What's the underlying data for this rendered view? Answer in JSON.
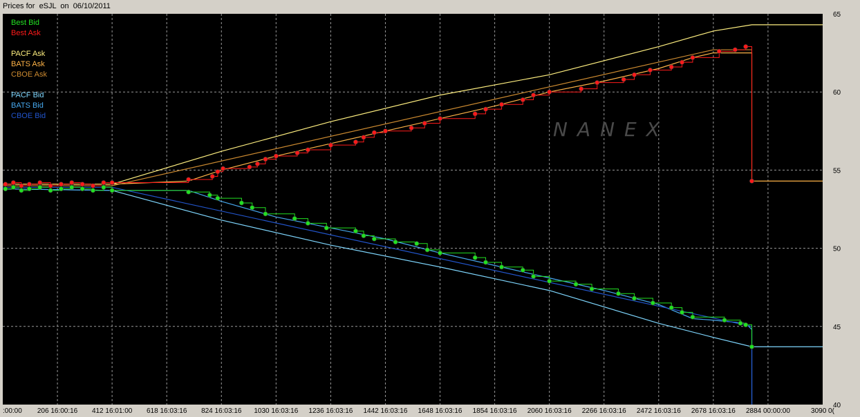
{
  "window": {
    "title": "Prices for  eSJL  on  06/10/2011"
  },
  "watermark": "NANEX",
  "colors": {
    "background": "#000000",
    "grid": "#9a9a9a",
    "best_bid": "#22e022",
    "best_ask": "#ff1a1a",
    "pacf_ask": "#ffef80",
    "bats_ask": "#ffb347",
    "cboe_ask": "#cc8a30",
    "pacf_bid": "#7fd7ff",
    "bats_bid": "#46a8ee",
    "cboe_bid": "#2255cc"
  },
  "chart_data": {
    "type": "line",
    "title": "Prices for  eSJL  on  06/10/2011",
    "xlabel": "",
    "ylabel": "",
    "x_range": [
      0,
      3090
    ],
    "ylim": [
      40,
      65
    ],
    "y_axis_side": "right",
    "grid": true,
    "legend_placement": "top-left",
    "x_ticks": [
      {
        "value": 0,
        "label": ":00:00"
      },
      {
        "value": 206,
        "label": "206 16:00:16"
      },
      {
        "value": 412,
        "label": "412 16:01:00"
      },
      {
        "value": 618,
        "label": "618 16:03:16"
      },
      {
        "value": 824,
        "label": "824 16:03:16"
      },
      {
        "value": 1030,
        "label": "1030 16:03:16"
      },
      {
        "value": 1236,
        "label": "1236 16:03:16"
      },
      {
        "value": 1442,
        "label": "1442 16:03:16"
      },
      {
        "value": 1648,
        "label": "1648 16:03:16"
      },
      {
        "value": 1854,
        "label": "1854 16:03:16"
      },
      {
        "value": 2060,
        "label": "2060 16:03:16"
      },
      {
        "value": 2266,
        "label": "2266 16:03:16"
      },
      {
        "value": 2472,
        "label": "2472 16:03:16"
      },
      {
        "value": 2678,
        "label": "2678 16:03:16"
      },
      {
        "value": 2884,
        "label": "2884 00:00:00"
      },
      {
        "value": 3090,
        "label": "3090 0("
      }
    ],
    "y_ticks": [
      {
        "value": 40,
        "label": "40"
      },
      {
        "value": 45,
        "label": "45"
      },
      {
        "value": 50,
        "label": "50"
      },
      {
        "value": 55,
        "label": "55"
      },
      {
        "value": 60,
        "label": "60"
      },
      {
        "value": 65,
        "label": "65"
      }
    ],
    "legend": [
      {
        "name": "Best Bid",
        "color_key": "best_bid"
      },
      {
        "name": "Best Ask",
        "color_key": "best_ask"
      },
      {
        "name": "PACF Ask",
        "color_key": "pacf_ask"
      },
      {
        "name": "BATS Ask",
        "color_key": "bats_ask"
      },
      {
        "name": "CBOE Ask",
        "color_key": "cboe_ask"
      },
      {
        "name": "PACF Bid",
        "color_key": "pacf_bid"
      },
      {
        "name": "BATS Bid",
        "color_key": "bats_bid"
      },
      {
        "name": "CBOE Bid",
        "color_key": "cboe_bid"
      }
    ],
    "series": [
      {
        "name": "PACF Ask",
        "color_key": "pacf_ask",
        "points": [
          [
            0,
            54.1
          ],
          [
            412,
            54.1
          ],
          [
            824,
            56.2
          ],
          [
            1236,
            58.1
          ],
          [
            1648,
            59.8
          ],
          [
            2060,
            61.1
          ],
          [
            2472,
            62.9
          ],
          [
            2678,
            63.9
          ],
          [
            2823,
            64.3
          ],
          [
            3090,
            64.3
          ]
        ]
      },
      {
        "name": "BATS Ask",
        "color_key": "bats_ask",
        "points": [
          [
            0,
            54.1
          ],
          [
            412,
            54.1
          ],
          [
            700,
            54.3
          ],
          [
            824,
            55.0
          ],
          [
            1030,
            55.9
          ],
          [
            1236,
            56.7
          ],
          [
            1442,
            57.5
          ],
          [
            1648,
            58.3
          ],
          [
            1854,
            59.1
          ],
          [
            2060,
            60.0
          ],
          [
            2266,
            60.7
          ],
          [
            2472,
            61.5
          ],
          [
            2600,
            62.2
          ],
          [
            2678,
            62.5
          ],
          [
            2823,
            62.5
          ],
          [
            2823,
            54.3
          ],
          [
            3090,
            54.3
          ]
        ]
      },
      {
        "name": "CBOE Ask",
        "color_key": "cboe_ask",
        "points": [
          [
            0,
            54.0
          ],
          [
            412,
            54.0
          ],
          [
            2678,
            62.7
          ],
          [
            2823,
            62.7
          ]
        ]
      },
      {
        "name": "PACF Bid",
        "color_key": "pacf_bid",
        "points": [
          [
            0,
            53.8
          ],
          [
            412,
            53.7
          ],
          [
            824,
            51.8
          ],
          [
            1236,
            50.2
          ],
          [
            1648,
            48.8
          ],
          [
            2060,
            47.3
          ],
          [
            2472,
            45.2
          ],
          [
            2678,
            44.3
          ],
          [
            2823,
            43.7
          ],
          [
            3090,
            43.7
          ]
        ]
      },
      {
        "name": "BATS Bid",
        "color_key": "bats_bid",
        "points": [
          [
            0,
            53.8
          ],
          [
            412,
            53.7
          ],
          [
            700,
            53.7
          ],
          [
            824,
            53.0
          ],
          [
            1030,
            52.0
          ],
          [
            1236,
            51.3
          ],
          [
            1442,
            50.6
          ],
          [
            1648,
            49.7
          ],
          [
            1854,
            48.9
          ],
          [
            2060,
            48.1
          ],
          [
            2266,
            47.3
          ],
          [
            2472,
            46.4
          ],
          [
            2600,
            45.5
          ],
          [
            2678,
            45.4
          ],
          [
            2800,
            45.2
          ],
          [
            2823,
            44.8
          ],
          [
            2823,
            43.7
          ],
          [
            2823,
            40.0
          ]
        ]
      },
      {
        "name": "CBOE Bid",
        "color_key": "cboe_bid",
        "points": [
          [
            0,
            53.9
          ],
          [
            412,
            53.9
          ],
          [
            2823,
            45.0
          ],
          [
            2823,
            40.0
          ]
        ]
      },
      {
        "name": "Best Ask",
        "color_key": "best_ask",
        "marker": "circle",
        "points": [
          [
            10,
            54.1
          ],
          [
            40,
            54.2
          ],
          [
            70,
            54.0
          ],
          [
            100,
            54.1
          ],
          [
            140,
            54.2
          ],
          [
            180,
            54.0
          ],
          [
            220,
            54.1
          ],
          [
            260,
            54.2
          ],
          [
            300,
            54.1
          ],
          [
            340,
            54.0
          ],
          [
            380,
            54.2
          ],
          [
            412,
            54.2
          ],
          [
            700,
            54.4
          ],
          [
            790,
            54.6
          ],
          [
            810,
            54.9
          ],
          [
            830,
            55.1
          ],
          [
            930,
            55.2
          ],
          [
            960,
            55.4
          ],
          [
            990,
            55.7
          ],
          [
            1030,
            55.9
          ],
          [
            1110,
            56.1
          ],
          [
            1150,
            56.3
          ],
          [
            1236,
            56.6
          ],
          [
            1330,
            56.8
          ],
          [
            1360,
            57.1
          ],
          [
            1400,
            57.4
          ],
          [
            1442,
            57.5
          ],
          [
            1540,
            57.7
          ],
          [
            1590,
            58.0
          ],
          [
            1648,
            58.3
          ],
          [
            1780,
            58.6
          ],
          [
            1820,
            58.9
          ],
          [
            1880,
            59.2
          ],
          [
            1960,
            59.5
          ],
          [
            2000,
            59.8
          ],
          [
            2060,
            60.0
          ],
          [
            2180,
            60.2
          ],
          [
            2240,
            60.6
          ],
          [
            2340,
            60.8
          ],
          [
            2380,
            61.1
          ],
          [
            2440,
            61.4
          ],
          [
            2520,
            61.6
          ],
          [
            2560,
            61.9
          ],
          [
            2600,
            62.2
          ],
          [
            2700,
            62.6
          ],
          [
            2760,
            62.7
          ],
          [
            2800,
            62.9
          ],
          [
            2823,
            54.3
          ]
        ]
      },
      {
        "name": "Best Bid",
        "color_key": "best_bid",
        "marker": "circle",
        "points": [
          [
            10,
            53.8
          ],
          [
            40,
            53.9
          ],
          [
            70,
            53.7
          ],
          [
            100,
            53.8
          ],
          [
            140,
            53.9
          ],
          [
            180,
            53.7
          ],
          [
            220,
            53.8
          ],
          [
            260,
            53.9
          ],
          [
            300,
            53.8
          ],
          [
            340,
            53.7
          ],
          [
            380,
            53.9
          ],
          [
            412,
            53.7
          ],
          [
            700,
            53.6
          ],
          [
            780,
            53.4
          ],
          [
            810,
            53.2
          ],
          [
            900,
            52.9
          ],
          [
            940,
            52.6
          ],
          [
            990,
            52.2
          ],
          [
            1100,
            51.9
          ],
          [
            1150,
            51.6
          ],
          [
            1220,
            51.3
          ],
          [
            1330,
            51.1
          ],
          [
            1360,
            50.8
          ],
          [
            1400,
            50.6
          ],
          [
            1480,
            50.4
          ],
          [
            1560,
            50.3
          ],
          [
            1600,
            49.9
          ],
          [
            1648,
            49.7
          ],
          [
            1780,
            49.4
          ],
          [
            1820,
            49.1
          ],
          [
            1880,
            48.8
          ],
          [
            1960,
            48.6
          ],
          [
            2000,
            48.2
          ],
          [
            2060,
            47.9
          ],
          [
            2160,
            47.7
          ],
          [
            2220,
            47.4
          ],
          [
            2320,
            47.1
          ],
          [
            2380,
            46.8
          ],
          [
            2450,
            46.5
          ],
          [
            2520,
            46.2
          ],
          [
            2560,
            45.9
          ],
          [
            2600,
            45.6
          ],
          [
            2720,
            45.4
          ],
          [
            2780,
            45.2
          ],
          [
            2800,
            45.1
          ],
          [
            2823,
            43.7
          ]
        ]
      }
    ]
  }
}
